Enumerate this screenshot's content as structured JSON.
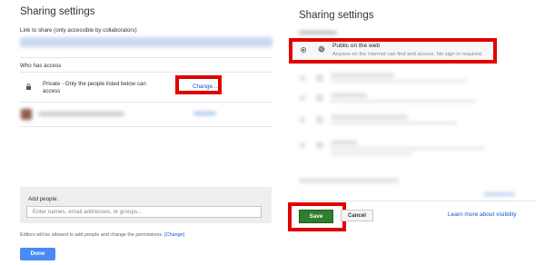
{
  "left": {
    "title": "Sharing settings",
    "link_label": "Link to share (only accessible by collaborators)",
    "who_has_access": "Who has access",
    "private_line1": "Private - Only the people listed below can",
    "private_line2": "access",
    "change_label": "Change...",
    "add_people_label": "Add people:",
    "add_people_placeholder": "Enter names, email addresses, or groups...",
    "editors_note": "Editors will be allowed to add people and change the permissions.",
    "editors_change": "[Change]",
    "done_label": "Done"
  },
  "right": {
    "title": "Sharing settings",
    "public_title": "Public on the web",
    "public_desc": "Anyone on the Internet can find and access. No sign-in required.",
    "save_label": "Save",
    "cancel_label": "Cancel",
    "learn_more": "Learn more about visibility"
  },
  "colors": {
    "highlight": "#e00000",
    "link": "#1155cc",
    "save": "#2f7d2f",
    "done": "#4a8af4"
  },
  "icons": [
    "lock-icon",
    "globe-icon",
    "radio-selected-icon",
    "cursor-icon"
  ]
}
